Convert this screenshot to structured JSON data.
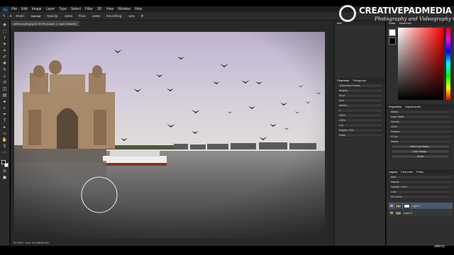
{
  "app": {
    "logo": "Ps"
  },
  "menu": [
    "File",
    "Edit",
    "Image",
    "Layer",
    "Type",
    "Select",
    "Filter",
    "3D",
    "View",
    "Window",
    "Help"
  ],
  "options": {
    "mode_label": "Mode:",
    "mode_value": "Normal",
    "opacity_label": "Opacity:",
    "opacity_value": "100%",
    "flow_label": "Flow:",
    "flow_value": "100%",
    "smoothing_label": "Smoothing:",
    "smoothing_value": "10%"
  },
  "document": {
    "tab": "selfexposed.jpg @ 33.3% (Layer 1, Layer Mask/8)",
    "zoom": "33.33%",
    "doc_info": "Doc: 40.2M/80.4M"
  },
  "panels": {
    "info_tab": "Info",
    "character_tabs": [
      "Character",
      "Paragraph"
    ],
    "character_rows": [
      "Times New Roman",
      "Regular",
      "36 pt",
      "Auto",
      "Metrics",
      "0",
      "100%",
      "100%",
      "0 pt",
      "English: USA",
      "Sharp"
    ],
    "color_tabs": [
      "Color",
      "Swatches"
    ],
    "properties_tabs": [
      "Properties",
      "Adjustments"
    ],
    "properties_rows": [
      "Masks",
      "Layer Mask",
      "Density:",
      "100%",
      "Feather:",
      "0.0 px",
      "Refine:"
    ],
    "properties_buttons": [
      "Select and Mask...",
      "Color Range...",
      "Invert"
    ],
    "layers_tabs": [
      "Layers",
      "Channels",
      "Paths"
    ],
    "layers_rows": [
      "Kind",
      "Normal",
      "Opacity: 100%",
      "Lock:",
      "Fill: 100%"
    ],
    "layers": [
      {
        "name": "Layer 1",
        "selected": true,
        "mask": true
      },
      {
        "name": "Layer 0",
        "selected": false,
        "mask": false
      }
    ]
  },
  "watermark": {
    "title": "CREATIVEPADMEDIA",
    "subtitle": "Photography and Videography Courses"
  },
  "udemy": "udemy"
}
